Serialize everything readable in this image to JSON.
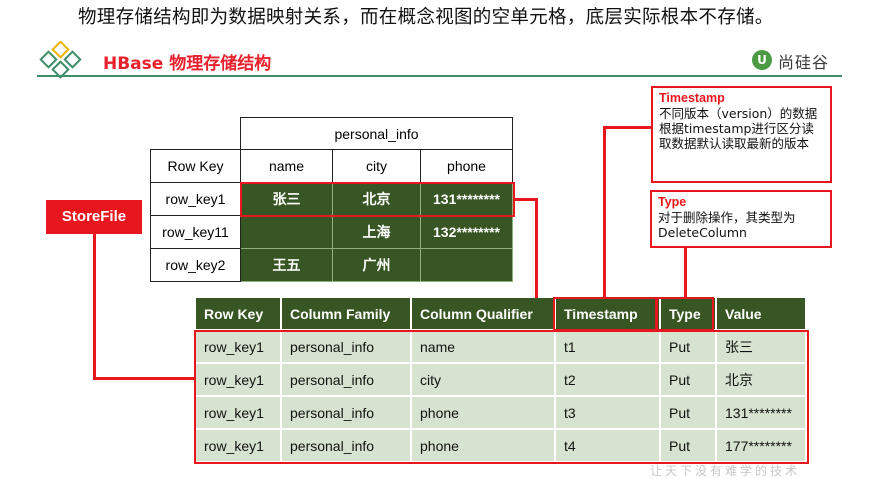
{
  "intro_text": "物理存储结构即为数据映射关系，而在概念视图的空单元格，底层实际根本不存储。",
  "header": {
    "title": "HBase 物理存储结构",
    "brand": "尚硅谷"
  },
  "colors": {
    "accent_red": "#e8161d",
    "dark_green": "#375623",
    "light_green": "#d6e3d0",
    "header_line": "#3e8e6a"
  },
  "upper_table": {
    "group_header": "personal_info",
    "row_key_header": "Row Key",
    "columns": [
      "name",
      "city",
      "phone"
    ],
    "rows": [
      {
        "key": "row_key1",
        "name": "张三",
        "city": "北京",
        "phone": "131********"
      },
      {
        "key": "row_key11",
        "name": "",
        "city": "上海",
        "phone": "132********"
      },
      {
        "key": "row_key2",
        "name": "王五",
        "city": "广州",
        "phone": ""
      }
    ]
  },
  "storefile_label": "StoreFile",
  "lower_table": {
    "headers": [
      "Row Key",
      "Column Family",
      "Column Qualifier",
      "Timestamp",
      "Type",
      "Value"
    ],
    "rows": [
      [
        "row_key1",
        "personal_info",
        "name",
        "t1",
        "Put",
        "张三"
      ],
      [
        "row_key1",
        "personal_info",
        "city",
        "t2",
        "Put",
        "北京"
      ],
      [
        "row_key1",
        "personal_info",
        "phone",
        "t3",
        "Put",
        "131********"
      ],
      [
        "row_key1",
        "personal_info",
        "phone",
        "t4",
        "Put",
        "177********"
      ]
    ]
  },
  "notes": {
    "timestamp": {
      "title": "Timestamp",
      "body": "不同版本（version）的数据根据timestamp进行区分读取数据默认读取最新的版本"
    },
    "type": {
      "title": "Type",
      "body": "对于删除操作，其类型为DeleteColumn"
    }
  },
  "watermark": "让天下没有难学的技术"
}
